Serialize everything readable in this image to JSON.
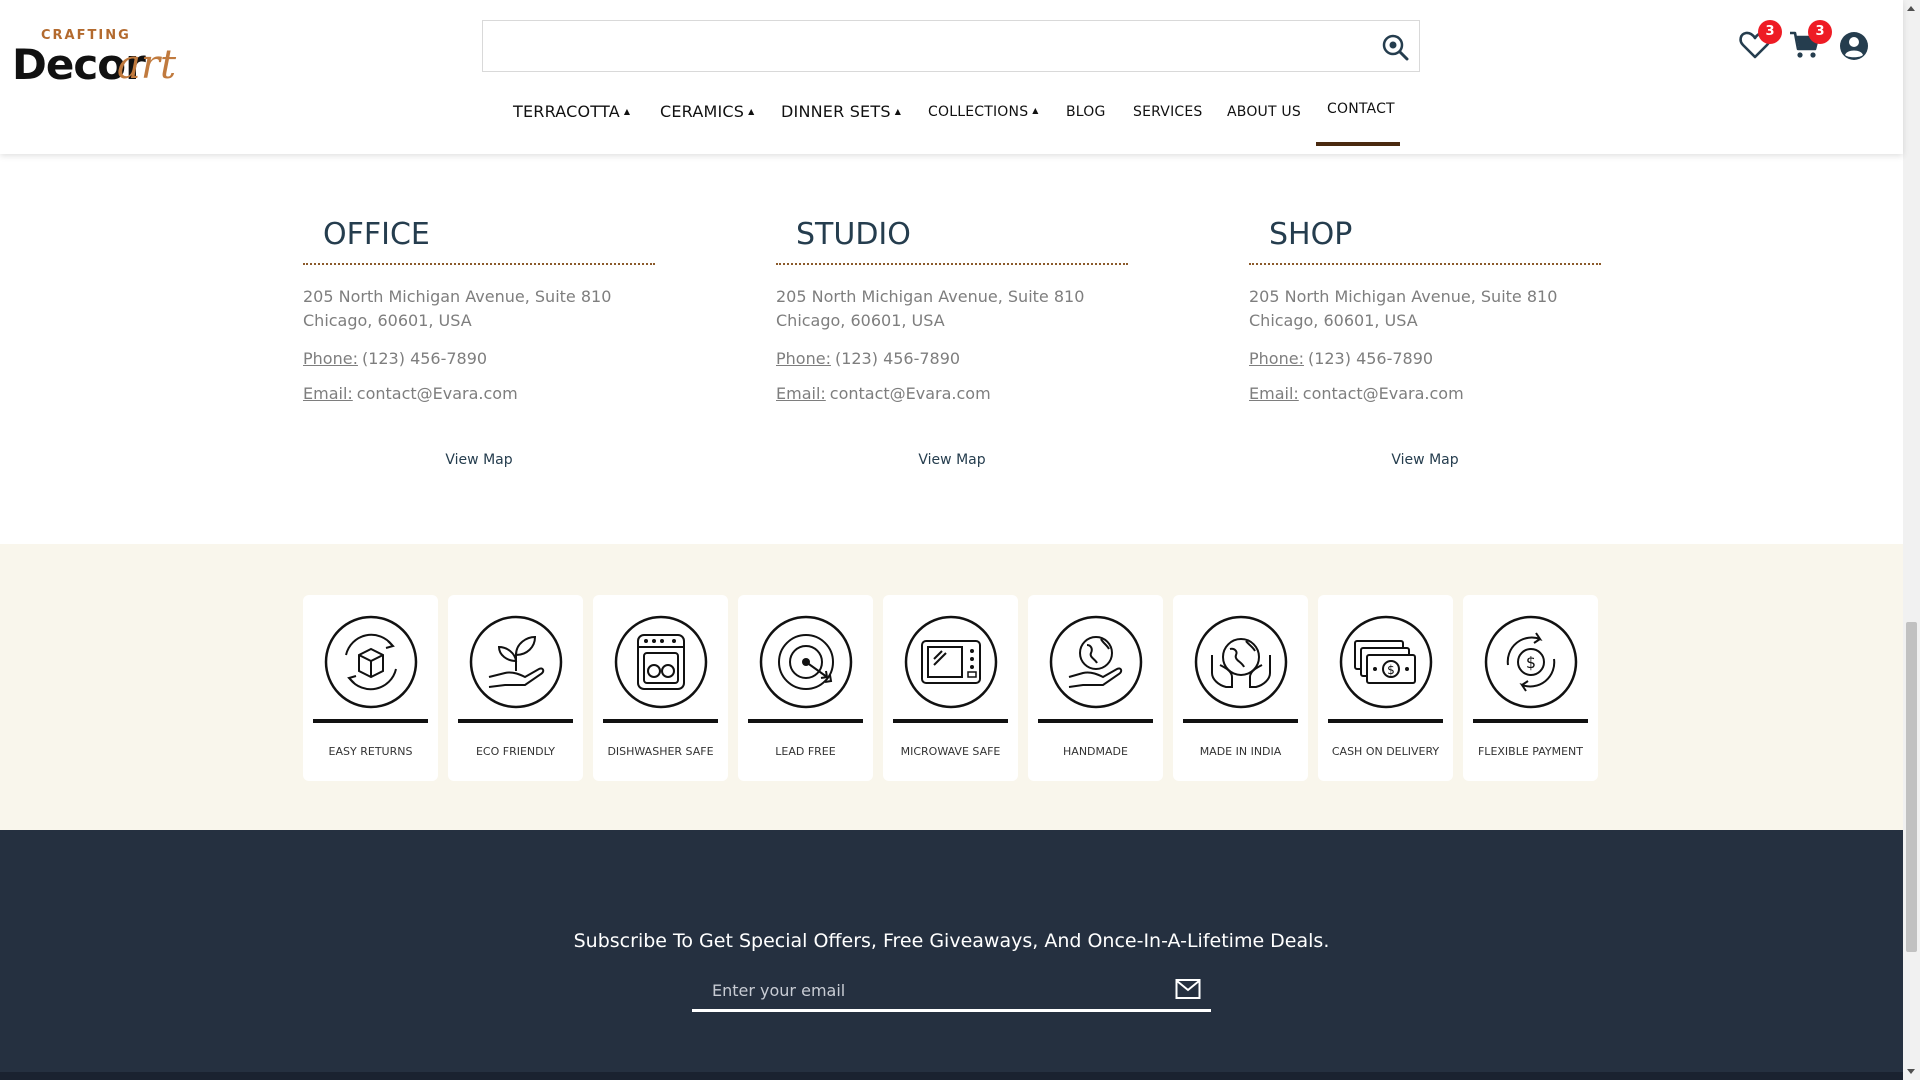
{
  "header": {
    "logo": {
      "small": "CRAFTING",
      "main": "Decor",
      "script": "art"
    },
    "search": {
      "placeholder": ""
    },
    "wishlist_count": "3",
    "cart_count": "3",
    "nav": [
      {
        "label": "TERRACOTTA",
        "caret": "▲"
      },
      {
        "label": "CERAMICS",
        "caret": "▲"
      },
      {
        "label": "DINNER SETS",
        "caret": "▲"
      },
      {
        "label": "COLLECTIONS",
        "caret": "▲"
      },
      {
        "label": "BLOG",
        "caret": ""
      },
      {
        "label": "SERVICES",
        "caret": ""
      },
      {
        "label": "ABOUT US",
        "caret": ""
      },
      {
        "label": "CONTACT",
        "caret": ""
      }
    ],
    "active_nav": "CONTACT"
  },
  "locations": [
    {
      "title": "OFFICE",
      "address": "205 North Michigan Avenue, Suite 810 Chicago, 60601, USA",
      "phone_label": "Phone:",
      "phone": "(123) 456-7890",
      "email_label": "Email:",
      "email": "contact@Evara.com",
      "map_label": "View Map"
    },
    {
      "title": "STUDIO",
      "address": "205 North Michigan Avenue, Suite 810 Chicago, 60601, USA",
      "phone_label": "Phone:",
      "phone": "(123) 456-7890",
      "email_label": "Email:",
      "email": "contact@Evara.com",
      "map_label": "View Map"
    },
    {
      "title": "SHOP",
      "address": "205 North Michigan Avenue, Suite 810 Chicago, 60601, USA",
      "phone_label": "Phone:",
      "phone": "(123) 456-7890",
      "email_label": "Email:",
      "email": "contact@Evara.com",
      "map_label": "View Map"
    }
  ],
  "features": [
    {
      "label": "EASY RETURNS",
      "icon": "box-return-icon"
    },
    {
      "label": "ECO FRIENDLY",
      "icon": "plant-hand-icon"
    },
    {
      "label": "DISHWASHER SAFE",
      "icon": "dishwasher-icon"
    },
    {
      "label": "LEAD FREE",
      "icon": "target-icon"
    },
    {
      "label": "MICROWAVE SAFE",
      "icon": "microwave-icon"
    },
    {
      "label": "HANDMADE",
      "icon": "globe-hand-icon"
    },
    {
      "label": "MADE IN INDIA",
      "icon": "globe-hands-icon"
    },
    {
      "label": "CASH ON DELIVERY",
      "icon": "cash-icon"
    },
    {
      "label": "FLEXIBLE PAYMENT",
      "icon": "dollar-cycle-icon"
    }
  ],
  "subscribe": {
    "title": "Subscribe To Get Special Offers, Free Giveaways, And Once-In-A-Lifetime Deals.",
    "placeholder": "Enter your email"
  },
  "colors": {
    "accent": "#8b5a2b",
    "footer_bg": "#253040",
    "features_bg": "#f9f6ec",
    "badge": "#ee1c25"
  }
}
